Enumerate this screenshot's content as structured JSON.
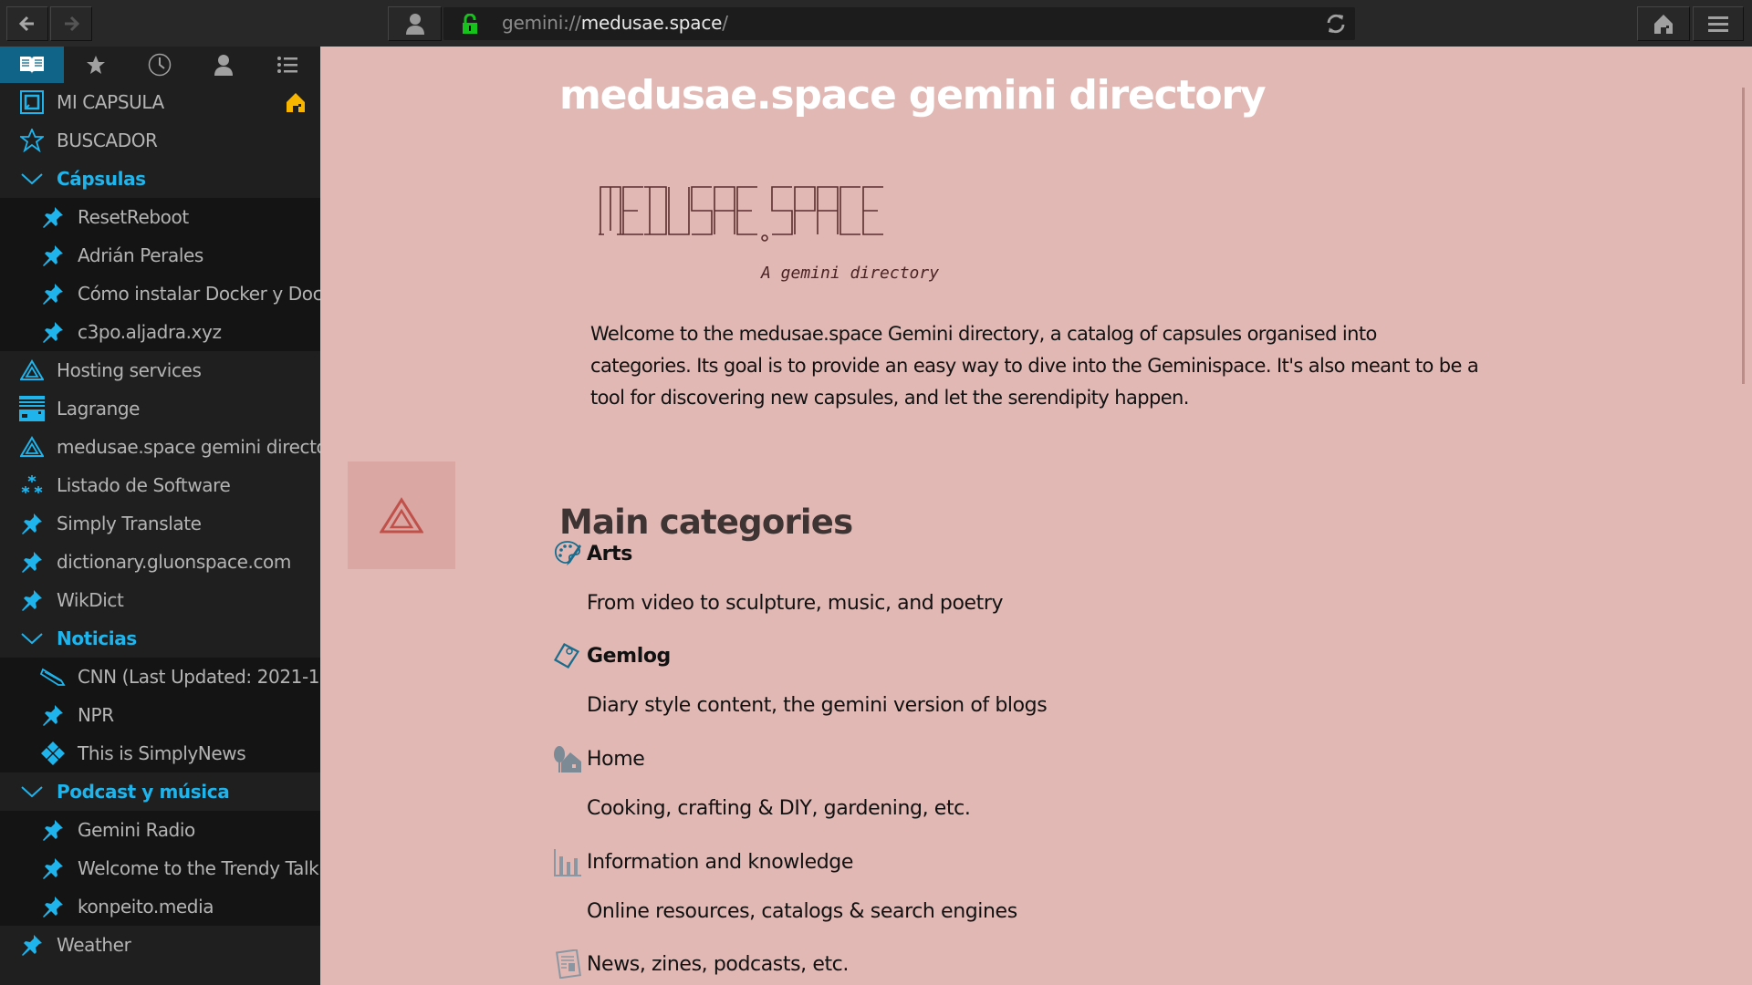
{
  "toolbar": {
    "back_icon": "arrow-left-icon",
    "forward_icon": "arrow-right-icon",
    "identity_icon": "person-icon",
    "url_scheme": "gemini://",
    "url_host": "medusae.space",
    "url_path": "/",
    "lock_color": "#17c21d",
    "reload_icon": "reload-icon",
    "home_icon": "home-icon",
    "menu_icon": "hamburger-menu-icon"
  },
  "sidebar": {
    "tabs": [
      {
        "name": "bookmarks",
        "icon": "open-book-icon",
        "active": true
      },
      {
        "name": "feeds",
        "icon": "star-icon",
        "active": false
      },
      {
        "name": "history",
        "icon": "clock-icon",
        "active": false
      },
      {
        "name": "identities",
        "icon": "person-icon",
        "active": false
      },
      {
        "name": "outline",
        "icon": "list-icon",
        "active": false
      }
    ],
    "items": [
      {
        "label": "MI CAPSULA",
        "icon": "square-frame-icon",
        "type": "top",
        "home": true
      },
      {
        "label": "BUSCADOR",
        "icon": "star-outline-icon",
        "type": "top"
      },
      {
        "label": "Cápsulas",
        "icon": "chevron-down-icon",
        "type": "folder"
      },
      {
        "label": "ResetReboot",
        "icon": "pin-icon",
        "type": "child"
      },
      {
        "label": "Adrián Perales",
        "icon": "pin-icon",
        "type": "child"
      },
      {
        "label": "Cómo instalar Docker y Docker",
        "icon": "pin-icon",
        "type": "child"
      },
      {
        "label": "c3po.aljadra.xyz",
        "icon": "pin-icon",
        "type": "child"
      },
      {
        "label": "Hosting services",
        "icon": "triangle-icon",
        "type": "top"
      },
      {
        "label": "Lagrange",
        "icon": "city-icon",
        "type": "top"
      },
      {
        "label": "medusae.space gemini directory",
        "icon": "triangle-icon",
        "type": "top"
      },
      {
        "label": "Listado de Software",
        "icon": "sparkles-icon",
        "type": "top"
      },
      {
        "label": "Simply Translate",
        "icon": "pin-icon",
        "type": "top"
      },
      {
        "label": "dictionary.gluonspace.com",
        "icon": "pin-icon",
        "type": "top"
      },
      {
        "label": "WikDict",
        "icon": "pin-icon",
        "type": "top"
      },
      {
        "label": "Noticias",
        "icon": "chevron-down-icon",
        "type": "folder"
      },
      {
        "label": "CNN (Last Updated: 2021-1",
        "icon": "pencil-icon",
        "type": "child"
      },
      {
        "label": "NPR",
        "icon": "pin-icon",
        "type": "child"
      },
      {
        "label": "This is SimplyNews",
        "icon": "diamonds-icon",
        "type": "child"
      },
      {
        "label": "Podcast y música",
        "icon": "chevron-down-icon",
        "type": "folder"
      },
      {
        "label": "Gemini Radio",
        "icon": "pin-icon",
        "type": "child"
      },
      {
        "label": "Welcome to the Trendy Talk",
        "icon": "pin-icon",
        "type": "child"
      },
      {
        "label": "konpeito.media",
        "icon": "pin-icon",
        "type": "child"
      },
      {
        "label": "Weather",
        "icon": "pin-icon",
        "type": "top"
      }
    ]
  },
  "page": {
    "title": "medusae.space gemini directory",
    "ascii_logo": "MEDUSAE.SPACE",
    "tagline": "A gemini directory",
    "intro_lines": [
      "Welcome to the medusae.space Gemini directory, a catalog of capsules organised into",
      "categories. Its goal is to provide an easy way to dive into the Geminispace. It's also meant to be a",
      "tool for discovering new capsules, and let the serendipity happen."
    ],
    "favicon_icon": "triangle-icon",
    "section_heading": "Main categories",
    "categories": [
      {
        "title": "Arts",
        "desc": "From video to sculpture, music, and poetry",
        "icon": "palette-icon",
        "visited": true
      },
      {
        "title": "Gemlog",
        "desc": "Diary style content, the gemini version of blogs",
        "icon": "notebook-icon",
        "visited": true
      },
      {
        "title": "Home",
        "desc": "Cooking, crafting & DIY, gardening, etc.",
        "icon": "house-tree-icon",
        "visited": false
      },
      {
        "title": "Information and knowledge",
        "desc": "Online resources, catalogs & search engines",
        "icon": "bar-chart-icon",
        "visited": false
      },
      {
        "title": "News, zines, podcasts, etc.",
        "desc": "",
        "icon": "newspaper-icon",
        "visited": false
      }
    ]
  },
  "colors": {
    "accent": "#1fb4ec",
    "active_tab": "#0f6488",
    "page_bg": "#e1b8b4",
    "home_badge": "#f7b500"
  }
}
